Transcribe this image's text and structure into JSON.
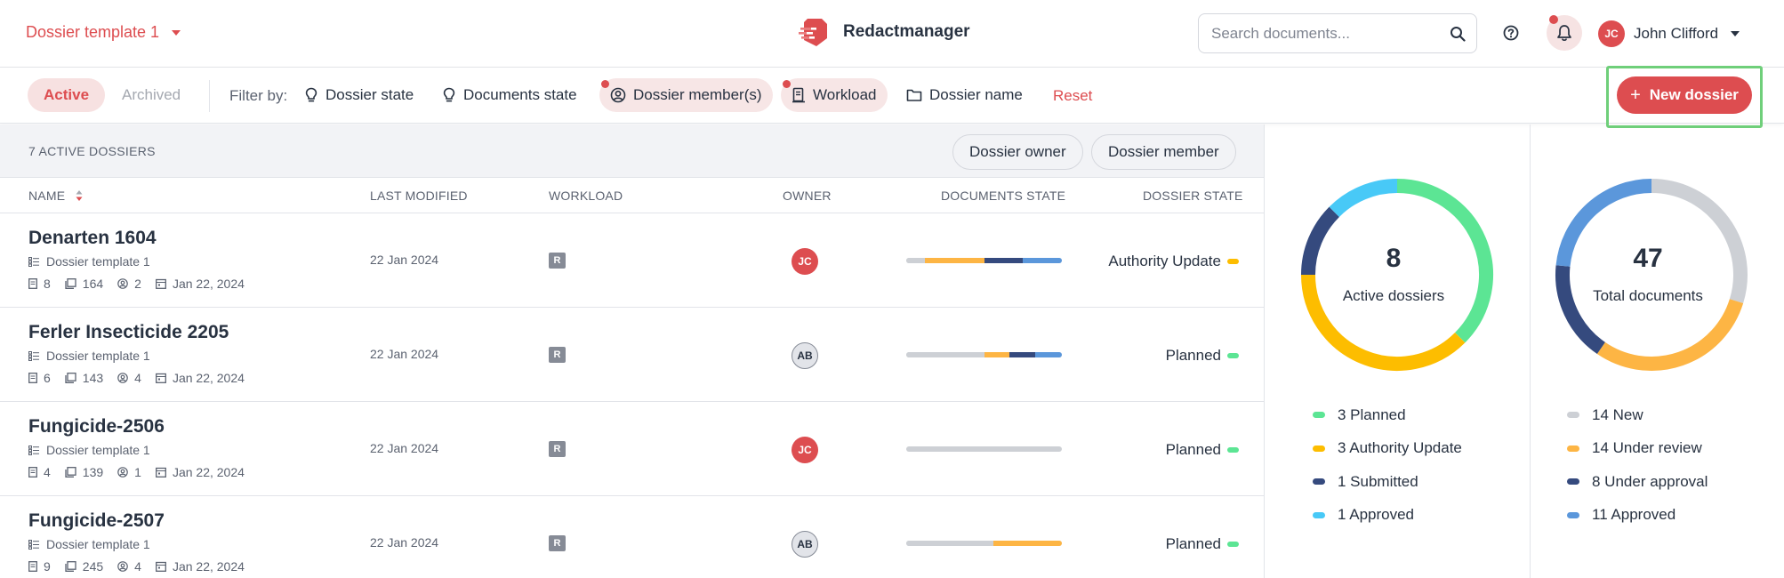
{
  "header": {
    "template_label": "Dossier template 1",
    "brand": "Redactmanager",
    "search_placeholder": "Search documents...",
    "user_initials": "JC",
    "user_name": "John Clifford"
  },
  "filterbar": {
    "tabs": {
      "active": "Active",
      "archived": "Archived"
    },
    "filter_label": "Filter by:",
    "filters": {
      "dossier_state": "Dossier state",
      "documents_state": "Documents state",
      "dossier_members": "Dossier member(s)",
      "workload": "Workload",
      "dossier_name": "Dossier name"
    },
    "reset": "Reset",
    "new_dossier": "New dossier"
  },
  "list": {
    "count_label": "7 ACTIVE DOSSIERS",
    "owner_button": "Dossier owner",
    "member_button": "Dossier member",
    "columns": {
      "name": "NAME",
      "last_modified": "LAST MODIFIED",
      "workload": "WORKLOAD",
      "owner": "OWNER",
      "documents_state": "DOCUMENTS STATE",
      "dossier_state": "DOSSIER STATE"
    },
    "rows": [
      {
        "name": "Denarten 1604",
        "template": "Dossier template 1",
        "docs": "8",
        "pages": "164",
        "members": "2",
        "date": "Jan 22, 2024",
        "last_modified": "22 Jan 2024",
        "workload": "R",
        "owner": "JC",
        "owner_style": "red",
        "state": "Authority Update",
        "state_color": "#fdbd00",
        "segments": [
          {
            "color": "#cdd0d5",
            "share": 12
          },
          {
            "color": "#fdb544",
            "share": 38
          },
          {
            "color": "#354a7e",
            "share": 25
          },
          {
            "color": "#5b97db",
            "share": 25
          }
        ]
      },
      {
        "name": "Ferler Insecticide 2205",
        "template": "Dossier template 1",
        "docs": "6",
        "pages": "143",
        "members": "4",
        "date": "Jan 22, 2024",
        "last_modified": "22 Jan 2024",
        "workload": "R",
        "owner": "AB",
        "owner_style": "grey",
        "state": "Planned",
        "state_color": "#5ce594",
        "segments": [
          {
            "color": "#cdd0d5",
            "share": 50
          },
          {
            "color": "#fdb544",
            "share": 16
          },
          {
            "color": "#354a7e",
            "share": 17
          },
          {
            "color": "#5b97db",
            "share": 17
          }
        ]
      },
      {
        "name": "Fungicide-2506",
        "template": "Dossier template 1",
        "docs": "4",
        "pages": "139",
        "members": "1",
        "date": "Jan 22, 2024",
        "last_modified": "22 Jan 2024",
        "workload": "R",
        "owner": "JC",
        "owner_style": "red",
        "state": "Planned",
        "state_color": "#5ce594",
        "segments": [
          {
            "color": "#cdd0d5",
            "share": 100
          }
        ]
      },
      {
        "name": "Fungicide-2507",
        "template": "Dossier template 1",
        "docs": "9",
        "pages": "245",
        "members": "4",
        "date": "Jan 22, 2024",
        "last_modified": "22 Jan 2024",
        "workload": "R",
        "owner": "AB",
        "owner_style": "grey",
        "state": "Planned",
        "state_color": "#5ce594",
        "segments": [
          {
            "color": "#cdd0d5",
            "share": 56
          },
          {
            "color": "#fdb544",
            "share": 44
          }
        ]
      }
    ]
  },
  "stats": {
    "dossiers": {
      "total": "8",
      "label": "Active dossiers",
      "items": [
        {
          "text": "3 Planned",
          "value": 3,
          "color": "#5ce594"
        },
        {
          "text": "3 Authority Update",
          "value": 3,
          "color": "#fdbd00"
        },
        {
          "text": "1 Submitted",
          "value": 1,
          "color": "#354a7e"
        },
        {
          "text": "1 Approved",
          "value": 1,
          "color": "#48c9f7"
        }
      ]
    },
    "documents": {
      "total": "47",
      "label": "Total documents",
      "items": [
        {
          "text": "14 New",
          "value": 14,
          "color": "#cdd0d5"
        },
        {
          "text": "14 Under review",
          "value": 14,
          "color": "#fdb544"
        },
        {
          "text": "8 Under approval",
          "value": 8,
          "color": "#354a7e"
        },
        {
          "text": "11 Approved",
          "value": 11,
          "color": "#5b97db"
        }
      ]
    }
  }
}
